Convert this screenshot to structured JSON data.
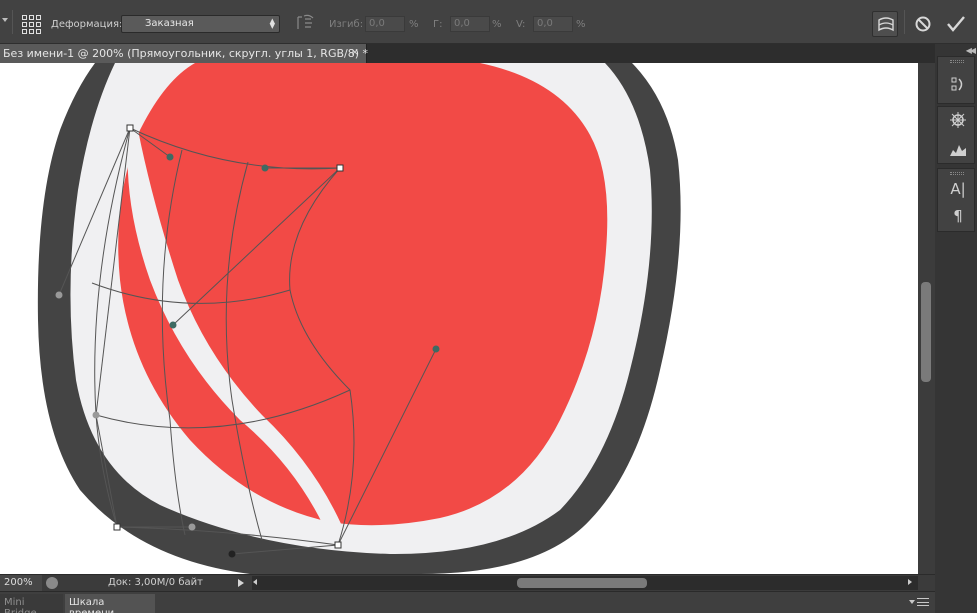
{
  "options": {
    "warp_label": "Деформация:",
    "warp_value": "Заказная",
    "bend_label": "Изгиб:",
    "bend_value": "0,0",
    "bend_unit": "%",
    "h_label": "Г:",
    "h_value": "0,0",
    "h_unit": "%",
    "v_label": "V:",
    "v_value": "0,0",
    "v_unit": "%"
  },
  "document": {
    "tab_title": "Без имени-1 @ 200% (Прямоугольник, скругл. углы 1, RGB/8) *",
    "close_glyph": "×"
  },
  "status": {
    "zoom": "200%",
    "doc_info": "Док: 3,00M/0 байт"
  },
  "bottom_tabs": [
    "Mini Bridge",
    "Шкала времени"
  ],
  "colors": {
    "shape_fill": "#f24a46",
    "shape_inner": "#f0f0f2",
    "shape_outer": "#444444",
    "canvas": "#ffffff"
  },
  "icons": {
    "reference_point": "grid-3x3-icon",
    "orientation": "warp-orientation-icon",
    "toggle_warp": "warp-mode-icon",
    "cancel": "cancel-icon",
    "commit": "checkmark-icon",
    "dock": [
      "history-icon",
      "navigator-icon",
      "histogram-icon",
      "character-icon",
      "paragraph-icon"
    ]
  }
}
